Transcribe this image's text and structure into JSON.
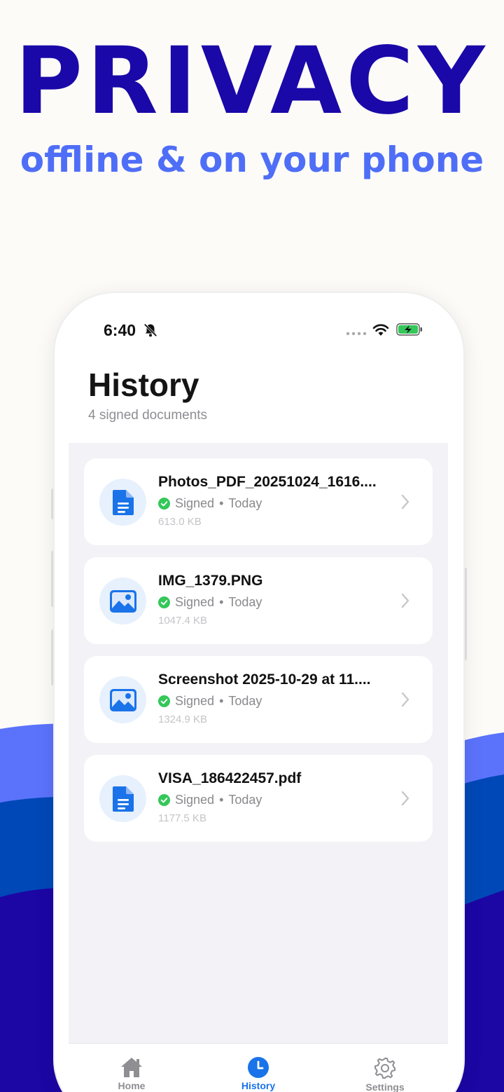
{
  "promo": {
    "headline": "PRIVACY",
    "subline": "offline & on your phone"
  },
  "status_bar": {
    "time": "6:40",
    "icons": [
      "bell-slash-icon",
      "signal-dots-icon",
      "wifi-icon",
      "battery-charging-icon"
    ]
  },
  "header": {
    "title": "History",
    "subtitle": "4 signed documents"
  },
  "documents": [
    {
      "name": "Photos_PDF_20251024_1616....",
      "status": "Signed",
      "date": "Today",
      "size": "613.0 KB",
      "icon": "document-icon"
    },
    {
      "name": "IMG_1379.PNG",
      "status": "Signed",
      "date": "Today",
      "size": "1047.4 KB",
      "icon": "image-icon"
    },
    {
      "name": "Screenshot 2025-10-29 at 11....",
      "status": "Signed",
      "date": "Today",
      "size": "1324.9 KB",
      "icon": "image-icon"
    },
    {
      "name": "VISA_186422457.pdf",
      "status": "Signed",
      "date": "Today",
      "size": "1177.5 KB",
      "icon": "document-icon"
    }
  ],
  "meta_separator": "•",
  "tabbar": {
    "tabs": [
      {
        "label": "Home",
        "icon": "home-icon",
        "active": false
      },
      {
        "label": "History",
        "icon": "clock-icon",
        "active": true
      },
      {
        "label": "Settings",
        "icon": "gear-icon",
        "active": false
      }
    ]
  },
  "colors": {
    "headline": "#1a08a8",
    "subline": "#4f6ef7",
    "accent": "#1a73e8",
    "signed_green": "#34c759",
    "wave_light": "#5b73fb",
    "wave_mid": "#0048b7",
    "wave_dark": "#1c06a4"
  }
}
